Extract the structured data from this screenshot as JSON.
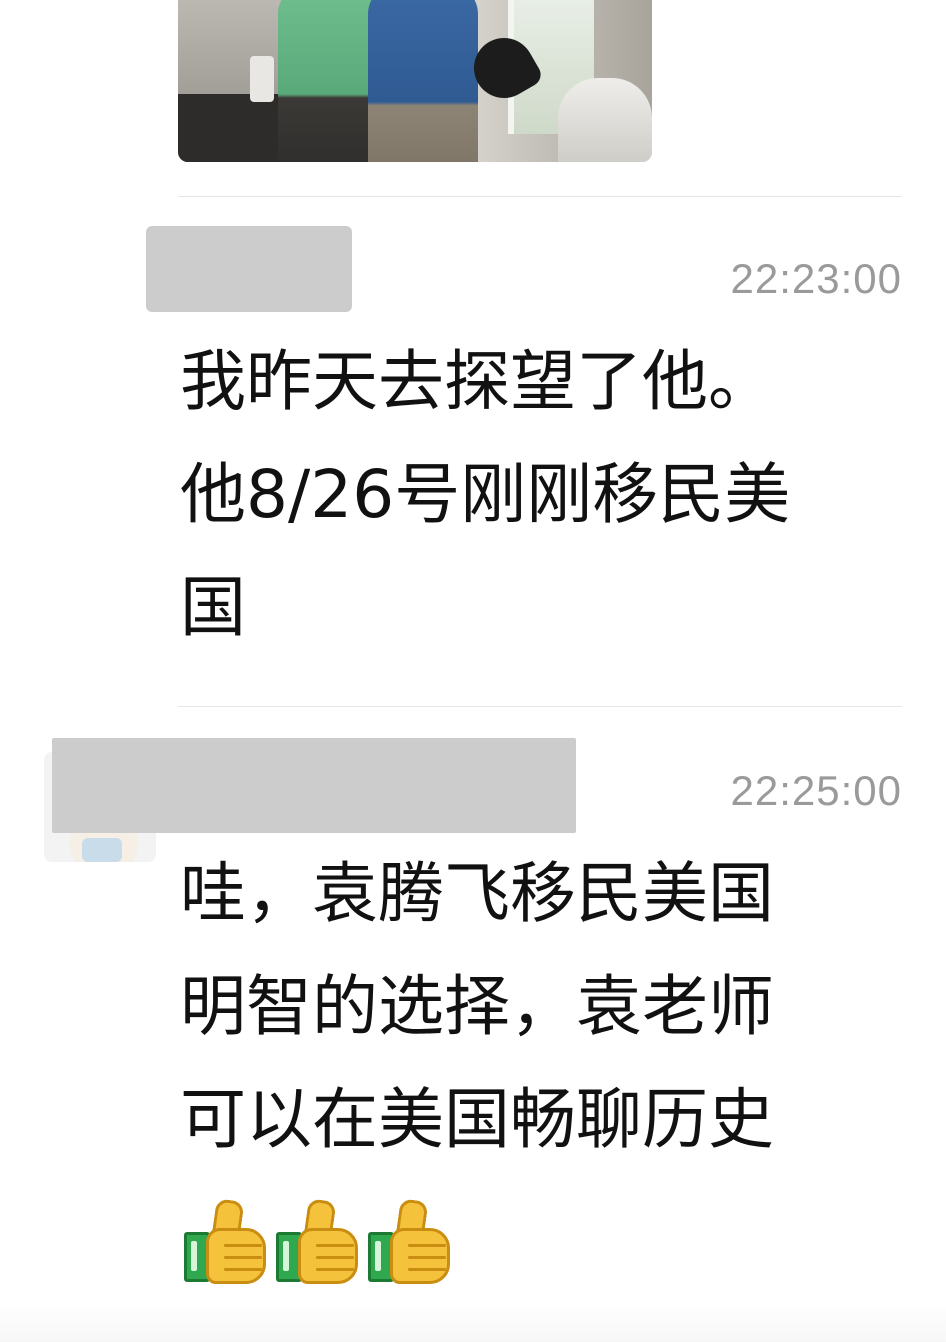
{
  "messages": [
    {
      "time": "22:23:00",
      "lines": [
        "我昨天去探望了他。",
        "他8/26号刚刚移民美",
        "国"
      ]
    },
    {
      "time": "22:25:00",
      "lines": [
        "哇，袁腾飞移民美国",
        "明智的选择，袁老师",
        "可以在美国畅聊历史"
      ],
      "emojis": [
        "thumbs-up",
        "thumbs-up",
        "thumbs-up"
      ]
    }
  ]
}
